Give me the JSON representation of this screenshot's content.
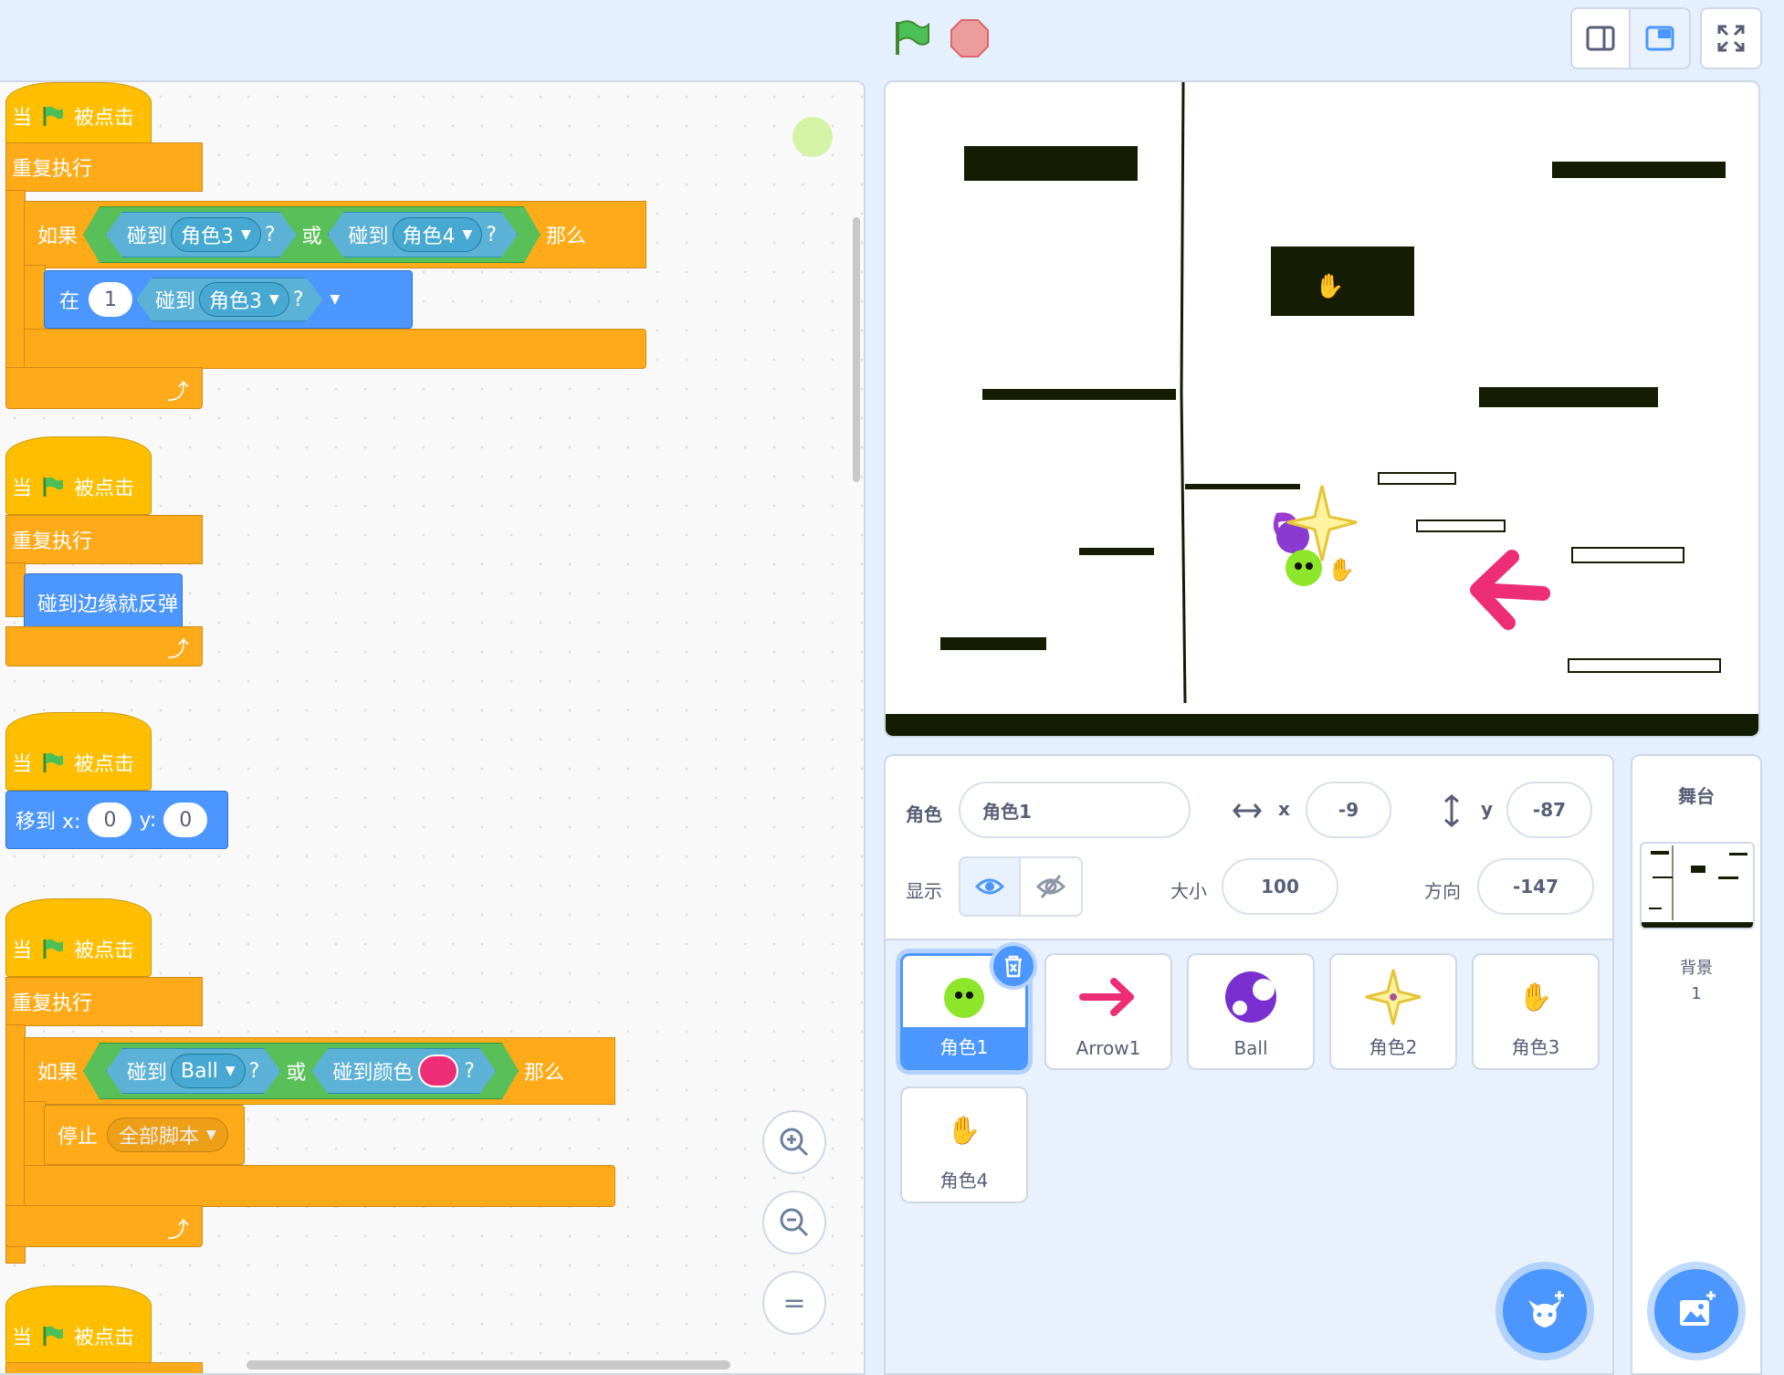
{
  "toolbar": {
    "green_flag_icon": "green-flag-icon",
    "stop_icon": "stop-sign-icon"
  },
  "scripts": {
    "s1": {
      "when": "当",
      "flag_clicked": "被点击",
      "forever": "重复执行",
      "if": "如果",
      "touching1": "碰到",
      "target1": "角色3",
      "q1": "?",
      "or": "或",
      "touching2": "碰到",
      "target2": "角色4",
      "q2": "?",
      "then": "那么",
      "at": "在",
      "at_value": "1",
      "touching3": "碰到",
      "target3": "角色3",
      "q3": "?"
    },
    "s2": {
      "when": "当",
      "flag_clicked": "被点击",
      "forever": "重复执行",
      "bounce": "碰到边缘就反弹"
    },
    "s3": {
      "when": "当",
      "flag_clicked": "被点击",
      "goto": "移到 x:",
      "x": "0",
      "ylabel": "y:",
      "y": "0"
    },
    "s4": {
      "when": "当",
      "flag_clicked": "被点击",
      "forever": "重复执行",
      "if": "如果",
      "touching1": "碰到",
      "target1": "Ball",
      "q1": "?",
      "or": "或",
      "touching_color": "碰到颜色",
      "q2": "?",
      "then": "那么",
      "stop": "停止",
      "stop_option": "全部脚本",
      "swatch_color": "#ee2d77"
    },
    "s5": {
      "when": "当",
      "flag_clicked": "被点击"
    }
  },
  "zoom": {
    "in": "zoom-in-icon",
    "out": "zoom-out-icon",
    "reset": "="
  },
  "sprite_info": {
    "sprite_label": "角色",
    "sprite_name": "角色1",
    "x_label": "x",
    "x_value": "-9",
    "y_label": "y",
    "y_value": "-87",
    "show_label": "显示",
    "size_label": "大小",
    "size_value": "100",
    "direction_label": "方向",
    "direction_value": "-147"
  },
  "sprites": [
    {
      "name": "角色1",
      "icon": "green-ball-icon",
      "selected": true
    },
    {
      "name": "Arrow1",
      "icon": "arrow-icon"
    },
    {
      "name": "Ball",
      "icon": "purple-ball-icon"
    },
    {
      "name": "角色2",
      "icon": "star-icon"
    },
    {
      "name": "角色3",
      "icon": "hand-icon"
    },
    {
      "name": "角色4",
      "icon": "hand-icon"
    }
  ],
  "stage_panel": {
    "title": "舞台",
    "backdrops_label": "背景",
    "backdrops_count": "1"
  },
  "colors": {
    "events": "#ffbf00",
    "control": "#ffab19",
    "motion": "#4c97ff",
    "sensing": "#5cb1d6",
    "operators": "#59c059",
    "accent": "#4c97ff",
    "arrow": "#ee2d77"
  }
}
